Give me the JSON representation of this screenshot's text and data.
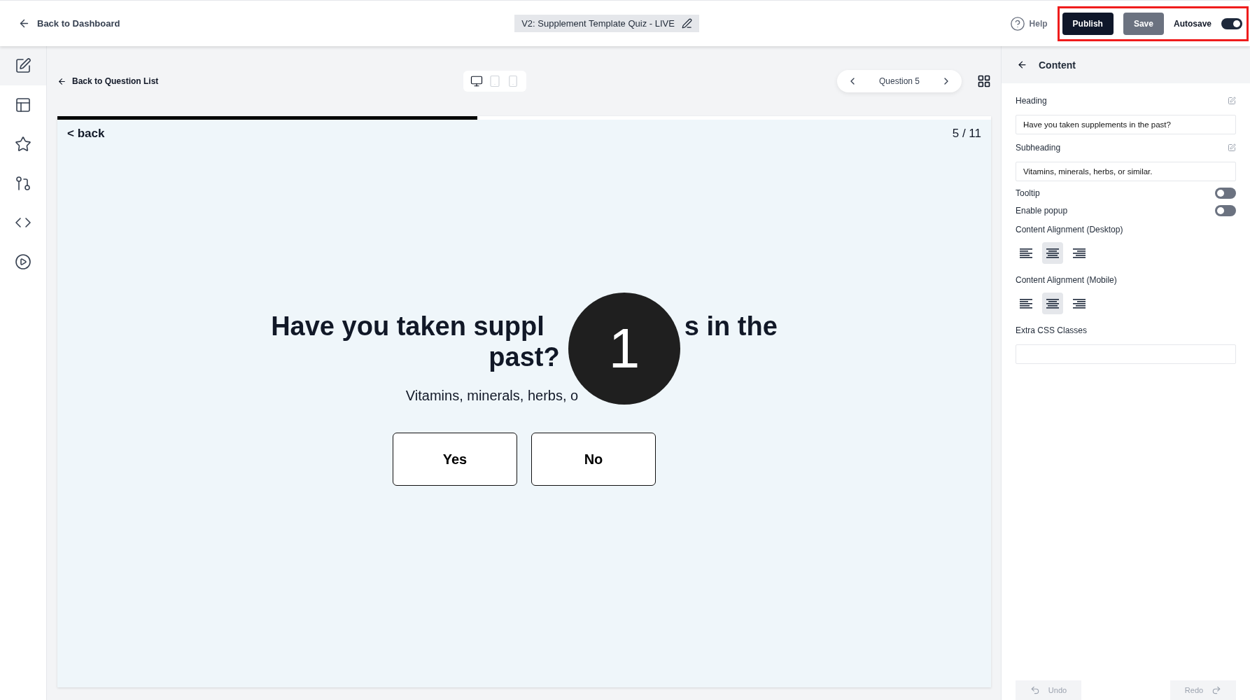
{
  "topbar": {
    "back_link": "Back to Dashboard",
    "title": "V2: Supplement Template Quiz - LIVE",
    "help": "Help",
    "publish": "Publish",
    "save": "Save",
    "autosave": {
      "label": "Autosave",
      "on": true
    },
    "highlighted": true
  },
  "sidebar": {
    "items": [
      {
        "selected": true
      },
      {
        "selected": false
      },
      {
        "selected": false
      },
      {
        "selected": false
      },
      {
        "selected": false
      },
      {
        "selected": false
      }
    ]
  },
  "editor": {
    "back_link": "Back to Question List",
    "devices": [
      {
        "selected": true
      },
      {
        "selected": false
      },
      {
        "selected": false
      }
    ],
    "question_nav": "Question 5"
  },
  "preview": {
    "progress": {
      "level": 0.45
    },
    "back": "< back",
    "counter": "5 / 11",
    "heading_parts": [
      "Have you taken suppl",
      "s in the",
      "past?"
    ],
    "subheading": "Vitamins, minerals, herbs, o",
    "answers": [
      "Yes",
      "No"
    ],
    "step_badge": "1"
  },
  "panel": {
    "title": "Content",
    "fields": [
      {
        "label": "Heading",
        "value": "Have you taken supplements in the past?"
      },
      {
        "label": "Subheading",
        "value": "Vitamins, minerals, herbs, or similar."
      }
    ],
    "toggles": [
      {
        "label": "Tooltip",
        "on": false
      },
      {
        "label": "Enable popup",
        "on": false
      }
    ],
    "alignments": [
      {
        "label": "Content Alignment (Desktop)",
        "options": [
          {
            "selected": false
          },
          {
            "selected": true
          },
          {
            "selected": false
          }
        ]
      },
      {
        "label": "Content Alignment (Mobile)",
        "options": [
          {
            "selected": false
          },
          {
            "selected": true
          },
          {
            "selected": false
          }
        ]
      }
    ],
    "css_label": "Extra CSS Classes",
    "undo": "Undo",
    "redo": "Redo"
  }
}
